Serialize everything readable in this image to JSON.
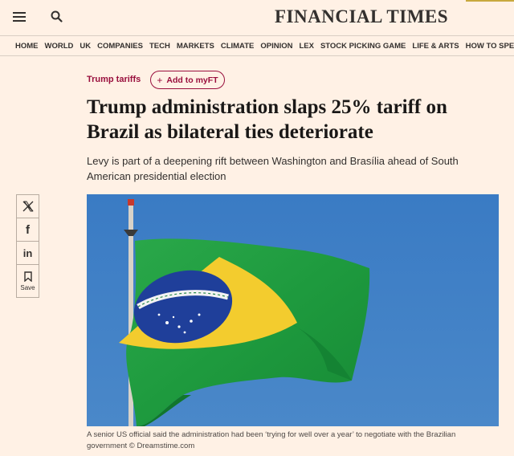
{
  "header": {
    "masthead": "FINANCIAL TIMES",
    "menu_icon": "hamburger-menu-icon",
    "search_icon": "search-icon"
  },
  "nav": {
    "items": [
      "HOME",
      "WORLD",
      "UK",
      "COMPANIES",
      "TECH",
      "MARKETS",
      "CLIMATE",
      "OPINION",
      "LEX",
      "STOCK PICKING GAME",
      "LIFE & ARTS",
      "HOW TO SPEND IT"
    ]
  },
  "article": {
    "topic": "Trump tariffs",
    "myft_label": "Add to myFT",
    "headline": "Trump administration slaps 25% tariff on Brazil as bilateral ties deteriorate",
    "standfirst": "Levy is part of a deepening rift between Washington and Brasília ahead of South American presidential election",
    "caption": "A senior US official said the administration had been ‘trying for well over a year’ to negotiate with the Brazilian government © Dreamstime.com"
  },
  "share": {
    "x_icon": "x-twitter-icon",
    "facebook_glyph": "f",
    "linkedin_glyph": "in",
    "save_label": "Save"
  },
  "colors": {
    "background": "#fff1e5",
    "claret": "#990f3d",
    "text": "#33302e",
    "sky": "#3f7fc3"
  }
}
